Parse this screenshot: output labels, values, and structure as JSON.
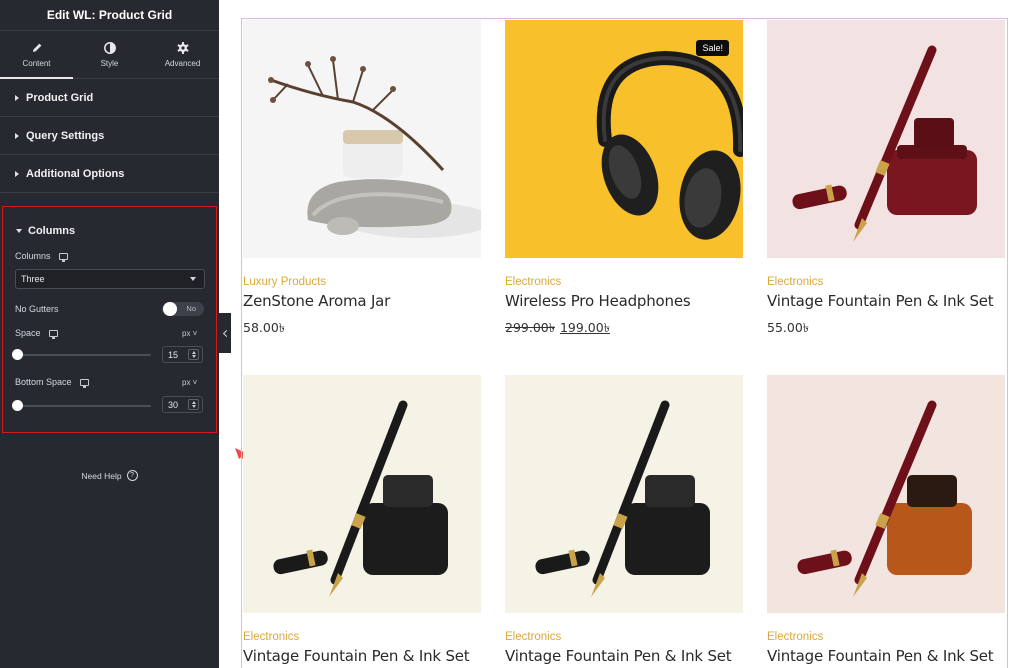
{
  "panel": {
    "title": "Edit WL: Product Grid",
    "tabs": [
      {
        "label": "Content",
        "icon": "pencil-icon"
      },
      {
        "label": "Style",
        "icon": "half-circle-icon"
      },
      {
        "label": "Advanced",
        "icon": "gear-icon"
      }
    ],
    "sections": [
      "Product Grid",
      "Query Settings",
      "Additional Options"
    ],
    "columns_section": {
      "title": "Columns",
      "columns_label": "Columns",
      "columns_value": "Three",
      "no_gutters_label": "No Gutters",
      "no_gutters_state": "No",
      "space_label": "Space",
      "space_unit": "px",
      "space_value": "15",
      "bottom_space_label": "Bottom Space",
      "bottom_space_unit": "px",
      "bottom_space_value": "30"
    },
    "help_label": "Need Help"
  },
  "products": [
    {
      "category": "Luxury Products",
      "name": "ZenStone Aroma Jar",
      "price": "58.00৳",
      "old_price": "",
      "badge": ""
    },
    {
      "category": "Electronics",
      "name": "Wireless Pro Headphones",
      "price": "199.00৳",
      "old_price": "299.00৳",
      "badge": "Sale!"
    },
    {
      "category": "Electronics",
      "name": "Vintage Fountain Pen & Ink Set",
      "price": "55.00৳",
      "old_price": "",
      "badge": ""
    },
    {
      "category": "Electronics",
      "name": "Vintage Fountain Pen & Ink Set",
      "price": "",
      "old_price": "",
      "badge": ""
    },
    {
      "category": "Electronics",
      "name": "Vintage Fountain Pen & Ink Set",
      "price": "",
      "old_price": "",
      "badge": ""
    },
    {
      "category": "Electronics",
      "name": "Vintage Fountain Pen & Ink Set",
      "price": "",
      "old_price": "",
      "badge": ""
    }
  ],
  "colors": {
    "panel_bg": "#26292f",
    "highlight_border": "#d11c1c",
    "category": "#d9a83a",
    "frame_border": "#e2b6ec",
    "annotation_arrow": "#ea4a4a"
  }
}
